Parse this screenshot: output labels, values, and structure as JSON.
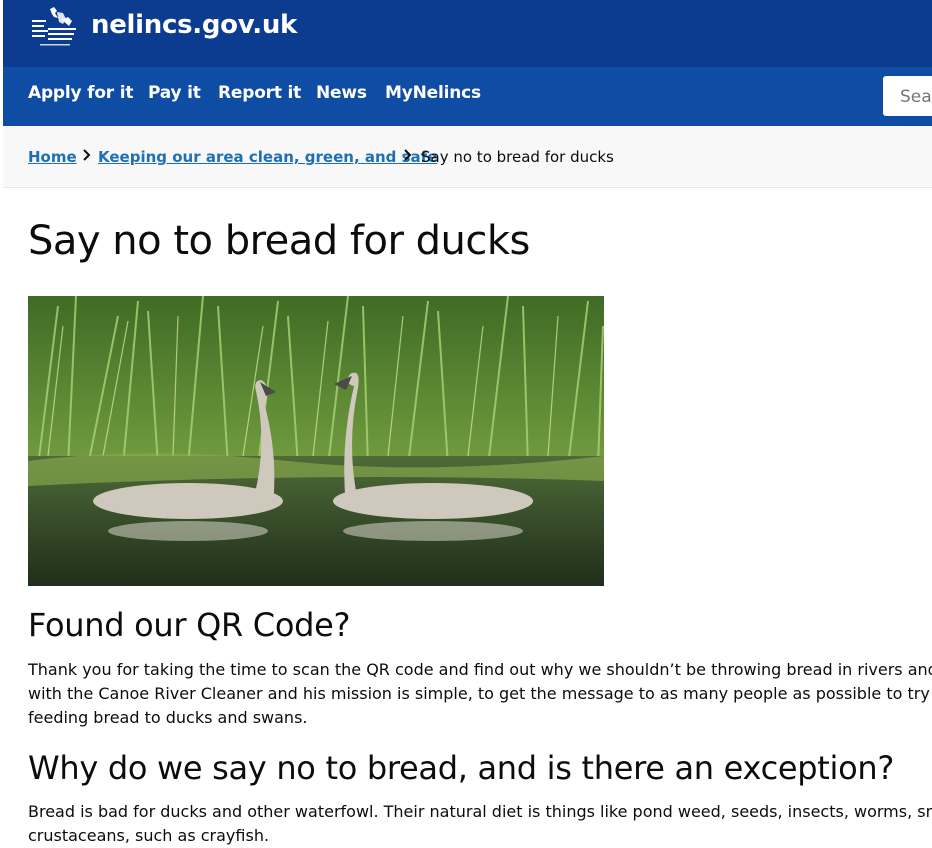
{
  "header": {
    "logo_alt": "North East Lincolnshire Council",
    "site_name": "nelincs.gov.uk"
  },
  "nav": {
    "items": [
      {
        "label": "Apply for it"
      },
      {
        "label": "Pay it"
      },
      {
        "label": "Report it"
      },
      {
        "label": "News"
      },
      {
        "label": "MyNelincs"
      }
    ],
    "search_placeholder": "Search"
  },
  "breadcrumb": {
    "home": "Home",
    "section": "Keeping our area clean, green, and safe",
    "current": "Say no to bread for ducks"
  },
  "page": {
    "title": "Say no to bread for ducks",
    "image_alt": "Two young swans swimming in front of tall reeds",
    "section1": {
      "heading": "Found our QR Code?",
      "lines": [
        "Thank you for taking the time to scan the QR code and find out why we shouldn’t be throwing bread in rivers and",
        "with the Canoe River Cleaner and his mission is simple, to get the message to as many people as possible to try ar",
        "feeding bread to ducks and swans."
      ]
    },
    "section2": {
      "heading": "Why do we say no to bread, and is there an exception?",
      "lines": [
        "Bread is bad for ducks and other waterfowl. Their natural diet is things like pond weed, seeds, insects, worms, smal",
        "crustaceans, such as crayfish."
      ]
    }
  },
  "colors": {
    "header_bg": "#0b3c8f",
    "nav_bg": "#0f4ca3",
    "link": "#1d70b8",
    "breadcrumb_bg": "#f8f8f8"
  }
}
